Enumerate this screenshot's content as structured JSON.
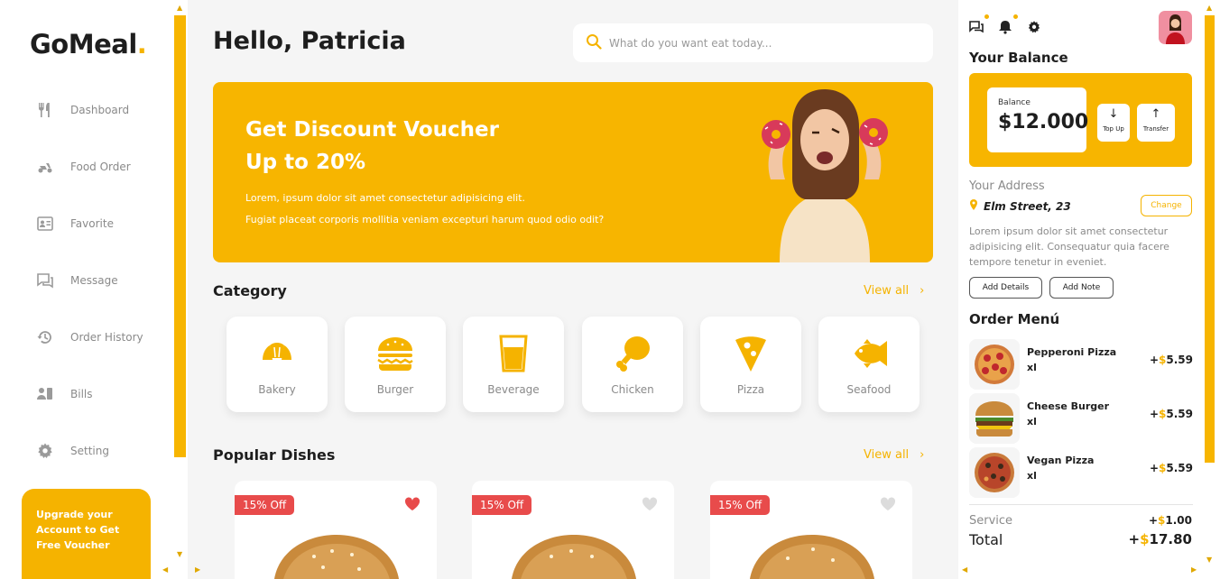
{
  "brand": {
    "name": "GoMeal",
    "dot": "."
  },
  "sidebar": {
    "items": [
      {
        "label": "Dashboard",
        "icon": "fork-knife-icon"
      },
      {
        "label": "Food Order",
        "icon": "scooter-icon"
      },
      {
        "label": "Favorite",
        "icon": "profile-card-icon"
      },
      {
        "label": "Message",
        "icon": "chat-icon"
      },
      {
        "label": "Order History",
        "icon": "history-icon"
      },
      {
        "label": "Bills",
        "icon": "bills-icon"
      },
      {
        "label": "Setting",
        "icon": "gear-icon"
      }
    ],
    "upgrade_text": "Upgrade your Account to Get Free Voucher"
  },
  "header": {
    "greeting": "Hello, Patricia",
    "search_placeholder": "What do you want eat today..."
  },
  "banner": {
    "title_line1": "Get Discount Voucher",
    "title_line2": "Up to 20%",
    "desc_line1": "Lorem, ipsum dolor sit amet consectetur adipisicing elit.",
    "desc_line2": "Fugiat placeat corporis mollitia veniam excepturi harum quod odio odit?"
  },
  "category": {
    "title": "Category",
    "view_all": "View all",
    "items": [
      {
        "label": "Bakery",
        "icon": "croissant-icon"
      },
      {
        "label": "Burger",
        "icon": "burger-icon"
      },
      {
        "label": "Beverage",
        "icon": "drink-icon"
      },
      {
        "label": "Chicken",
        "icon": "drumstick-icon"
      },
      {
        "label": "Pizza",
        "icon": "pizza-slice-icon"
      },
      {
        "label": "Seafood",
        "icon": "fish-icon"
      }
    ]
  },
  "popular": {
    "title": "Popular Dishes",
    "view_all": "View all",
    "dishes": [
      {
        "badge": "15% Off",
        "favorited": true
      },
      {
        "badge": "15% Off",
        "favorited": false
      },
      {
        "badge": "15% Off",
        "favorited": false
      }
    ]
  },
  "balance": {
    "title": "Your Balance",
    "label": "Balance",
    "amount": "$12.000",
    "top_up": "Top Up",
    "transfer": "Transfer"
  },
  "address": {
    "label": "Your Address",
    "street": "Elm Street, 23",
    "change": "Change",
    "description": "Lorem ipsum dolor sit amet consectetur adipisicing elit. Consequatur quia facere tempore tenetur in eveniet.",
    "add_details": "Add Details",
    "add_note": "Add Note"
  },
  "order": {
    "title": "Order Menú",
    "currency": "$",
    "items": [
      {
        "name": "Pepperoni Pizza",
        "size": "xl",
        "prefix": "+",
        "price": "5.59"
      },
      {
        "name": "Cheese Burger",
        "size": "xl",
        "prefix": "+",
        "price": "5.59"
      },
      {
        "name": "Vegan Pizza",
        "size": "xl",
        "prefix": "+",
        "price": "5.59"
      }
    ],
    "service_label": "Service",
    "service_prefix": "+",
    "service_value": "1.00",
    "total_label": "Total",
    "total_prefix": "+",
    "total_value": "17.80"
  },
  "colors": {
    "accent": "#f7b500",
    "badge": "#e84b4b",
    "muted": "#8a8a8a"
  }
}
